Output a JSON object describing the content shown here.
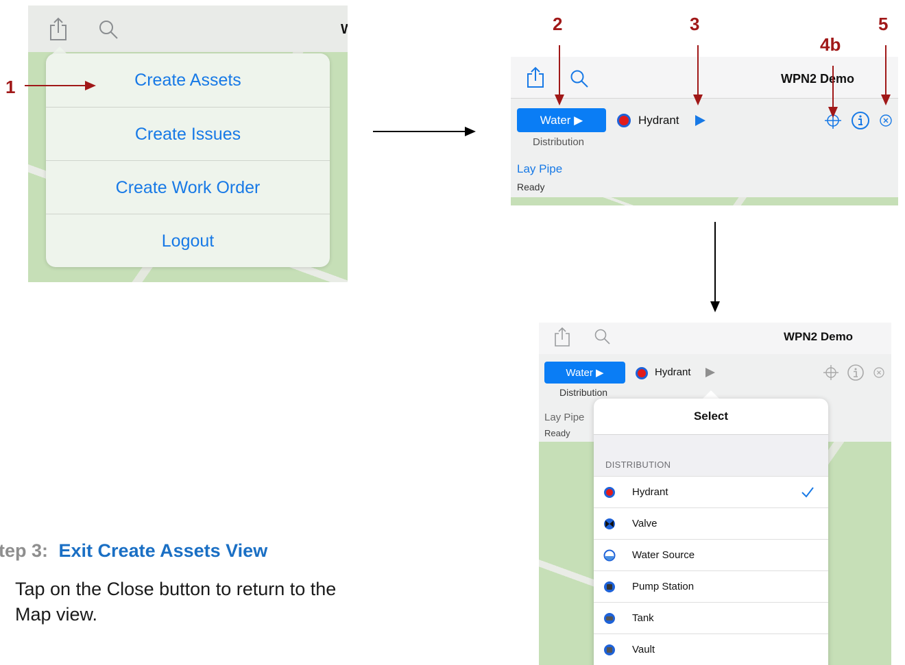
{
  "colors": {
    "accent": "#1779e6",
    "annotation": "#a01818",
    "button": "#0a7df5"
  },
  "panel1": {
    "title_partial": "W",
    "menu_items": [
      "Create Assets",
      "Create Issues",
      "Create Work Order",
      "Logout"
    ]
  },
  "panel2": {
    "title": "WPN2 Demo",
    "layer_button": "Water ▶",
    "layer_sublabel": "Distribution",
    "asset_type": "Hydrant",
    "action_link": "Lay Pipe",
    "status": "Ready"
  },
  "panel3": {
    "title": "WPN2 Demo",
    "layer_button": "Water ▶",
    "layer_sublabel": "Distribution",
    "asset_type": "Hydrant",
    "action_link": "Lay Pipe",
    "status": "Ready",
    "popover_title": "Select",
    "section_header": "DISTRIBUTION",
    "items": [
      {
        "label": "Hydrant",
        "icon": "hydrant-icon",
        "selected": true
      },
      {
        "label": "Valve",
        "icon": "valve-icon",
        "selected": false
      },
      {
        "label": "Water Source",
        "icon": "water-source-icon",
        "selected": false
      },
      {
        "label": "Pump Station",
        "icon": "pump-station-icon",
        "selected": false
      },
      {
        "label": "Tank",
        "icon": "tank-icon",
        "selected": false
      },
      {
        "label": "Vault",
        "icon": "vault-icon",
        "selected": false
      }
    ]
  },
  "annotations": {
    "a1": "1",
    "a2": "2",
    "a3": "3",
    "a4b": "4b",
    "a5": "5"
  },
  "instructions": {
    "step_prefix": "tep 3:",
    "step_title": "Exit Create Assets View",
    "body_line1": "Tap on the Close button to return to the",
    "body_line2": "Map view."
  }
}
